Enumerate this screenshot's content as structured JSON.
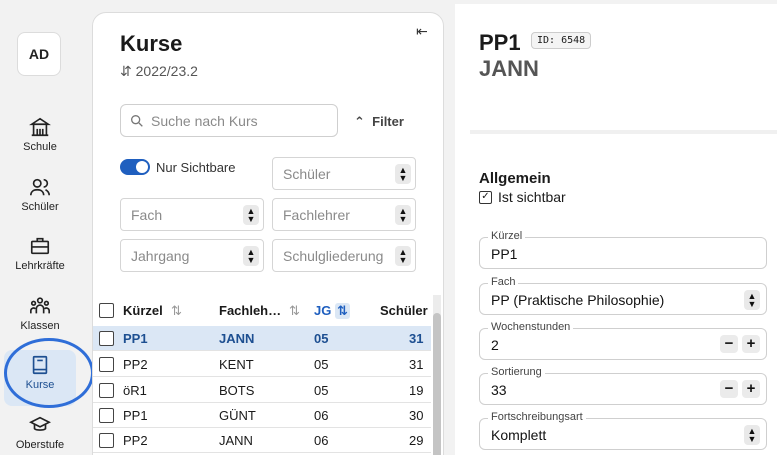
{
  "nav": {
    "avatar": "AD",
    "items": [
      {
        "label": "Schule",
        "icon": "building-icon"
      },
      {
        "label": "Schüler",
        "icon": "users-icon"
      },
      {
        "label": "Lehrkräfte",
        "icon": "briefcase-icon"
      },
      {
        "label": "Klassen",
        "icon": "group-icon"
      },
      {
        "label": "Kurse",
        "icon": "book-icon"
      },
      {
        "label": "Oberstufe",
        "icon": "graduation-cap-icon"
      }
    ],
    "active": "Kurse"
  },
  "list": {
    "title": "Kurse",
    "school_year": "2022/23.2",
    "search_placeholder": "Suche nach Kurs",
    "filter_label": "Filter",
    "toggle_label": "Nur Sichtbare",
    "toggle_on": true,
    "selects": {
      "schueler": "Schüler",
      "fach": "Fach",
      "fachlehrer": "Fachlehrer",
      "jahrgang": "Jahrgang",
      "schulgliederung": "Schulgliederung"
    },
    "columns": {
      "kuerzel": "Kürzel",
      "fachlehrer": "Fachleh…",
      "jg": "JG",
      "schueler": "Schüler"
    },
    "rows": [
      {
        "kuerzel": "PP1",
        "lehrer": "JANN",
        "jg": "05",
        "schueler": "31",
        "selected": true
      },
      {
        "kuerzel": "PP2",
        "lehrer": "KENT",
        "jg": "05",
        "schueler": "31",
        "selected": false
      },
      {
        "kuerzel": "öR1",
        "lehrer": "BOTS",
        "jg": "05",
        "schueler": "19",
        "selected": false
      },
      {
        "kuerzel": "PP1",
        "lehrer": "GÜNT",
        "jg": "06",
        "schueler": "30",
        "selected": false
      },
      {
        "kuerzel": "PP2",
        "lehrer": "JANN",
        "jg": "06",
        "schueler": "29",
        "selected": false
      }
    ]
  },
  "detail": {
    "title": "PP1",
    "id_badge": "ID: 6548",
    "subtitle": "JANN",
    "section": "Allgemein",
    "visible_label": "Ist sichtbar",
    "visible_checked": true,
    "fields": {
      "kuerzel": {
        "label": "Kürzel",
        "value": "PP1"
      },
      "fach": {
        "label": "Fach",
        "value": "PP (Praktische Philosophie)"
      },
      "wochenstunden": {
        "label": "Wochenstunden",
        "value": "2"
      },
      "sortierung": {
        "label": "Sortierung",
        "value": "33"
      },
      "fortschreibung": {
        "label": "Fortschreibungsart",
        "value": "Komplett"
      }
    }
  },
  "colors": {
    "accent": "#1f5fbf",
    "selected_row": "#dbe7f5",
    "highlight_ring": "#2f6ed8"
  }
}
